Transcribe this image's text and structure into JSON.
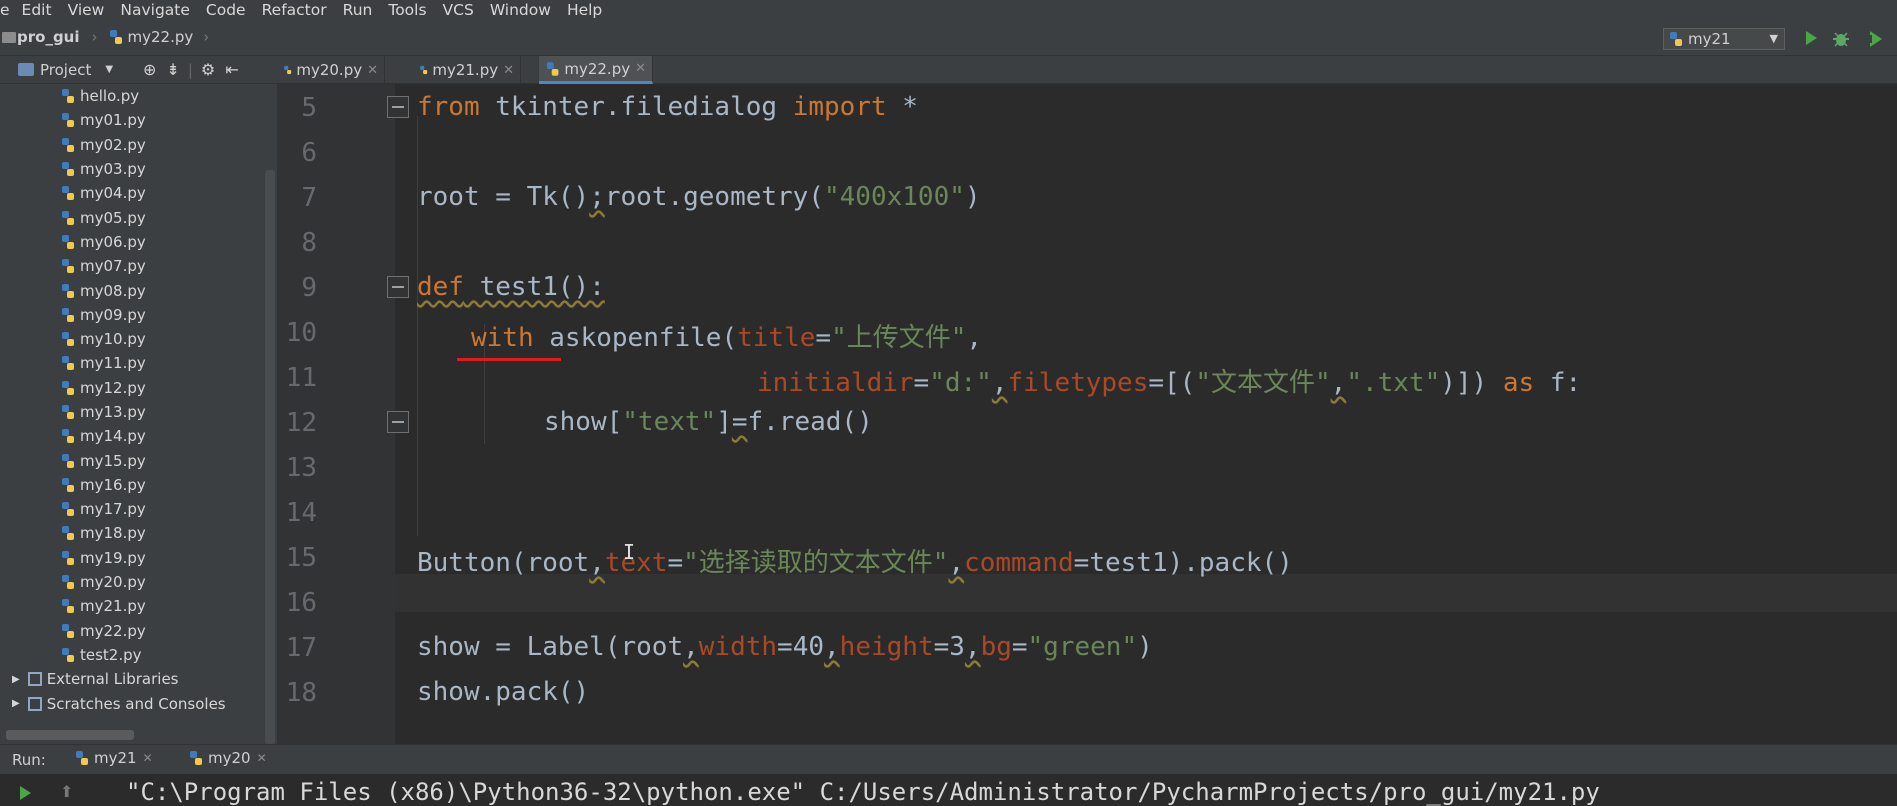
{
  "menu": [
    "e",
    "Edit",
    "View",
    "Navigate",
    "Code",
    "Refactor",
    "Run",
    "Tools",
    "VCS",
    "Window",
    "Help"
  ],
  "breadcrumb": {
    "project": "pro_gui",
    "file": "my22.py"
  },
  "run_config": {
    "selected": "my21"
  },
  "project_panel": {
    "title": "Project",
    "files": [
      "hello.py",
      "my01.py",
      "my02.py",
      "my03.py",
      "my04.py",
      "my05.py",
      "my06.py",
      "my07.py",
      "my08.py",
      "my09.py",
      "my10.py",
      "my11.py",
      "my12.py",
      "my13.py",
      "my14.py",
      "my15.py",
      "my16.py",
      "my17.py",
      "my18.py",
      "my19.py",
      "my20.py",
      "my21.py",
      "my22.py",
      "test2.py"
    ],
    "external_libraries": "External Libraries",
    "scratches": "Scratches and Consoles"
  },
  "editor_tabs": [
    {
      "label": "my20.py",
      "active": false
    },
    {
      "label": "my21.py",
      "active": false
    },
    {
      "label": "my22.py",
      "active": true
    }
  ],
  "line_numbers": [
    "5",
    "6",
    "7",
    "8",
    "9",
    "10",
    "11",
    "12",
    "13",
    "14",
    "15",
    "16",
    "17",
    "18"
  ],
  "code": {
    "l5": {
      "from": "from",
      "mod": " tkinter.filedialog ",
      "import": "import",
      "star": " *"
    },
    "l7": {
      "a": "root = Tk()",
      "comma": ";",
      "b": "root.geometry(",
      "s": "\"400x100\"",
      "c": ")"
    },
    "l9": {
      "def": "def",
      "name": " test1():"
    },
    "l10": {
      "with": "with",
      "a": " askopenfile(",
      "p": "title",
      "eq": "=",
      "s": "\"上传文件\"",
      "c": ","
    },
    "l11": {
      "p1": "initialdir",
      "eq1": "=",
      "s1": "\"d:\"",
      "c1": ",",
      "p2": "filetypes",
      "b": "=[(",
      "s2": "\"文本文件\"",
      "c2": ",",
      "s3": "\".txt\"",
      "e": ")]) ",
      "as": "as",
      "f": " f:"
    },
    "l12": {
      "a": "show[",
      "s": "\"text\"",
      "b": "]",
      "eq": "=",
      "c": "f.read()"
    },
    "l15": {
      "a": "Button(root",
      "c1": ",",
      "p1": "text",
      "eq": "=",
      "s": "\"选择读取的文本文件\"",
      "c2": ",",
      "p2": "command",
      "b": "=test1).pack()"
    },
    "l17": {
      "a": "show = Label(root",
      "c1": ",",
      "p1": "width",
      "v1": "=40",
      "c2": ",",
      "p2": "height",
      "v2": "=3",
      "c3": ",",
      "p3": "bg",
      "eq": "=",
      "s": "\"green\"",
      "e": ")"
    },
    "l18": {
      "a": "show.pack()"
    }
  },
  "run_bar": {
    "label": "Run:",
    "tabs": [
      {
        "label": "my21"
      },
      {
        "label": "my20"
      }
    ]
  },
  "console": {
    "line": "\"C:\\Program Files (x86)\\Python36-32\\python.exe\" C:/Users/Administrator/PycharmProjects/pro_gui/my21.py"
  },
  "colors": {
    "keyword": "#cc7832",
    "string": "#6a8759",
    "param": "#aa4926",
    "text": "#a9b7c6",
    "accent": "#4a88c7",
    "annotation_mark": "#e01b1b"
  },
  "icons": [
    "python-file-icon",
    "folder-icon",
    "run-icon",
    "debug-icon",
    "coverage-icon",
    "gear-icon",
    "target-icon",
    "collapse-icon",
    "hide-icon",
    "close-icon"
  ]
}
